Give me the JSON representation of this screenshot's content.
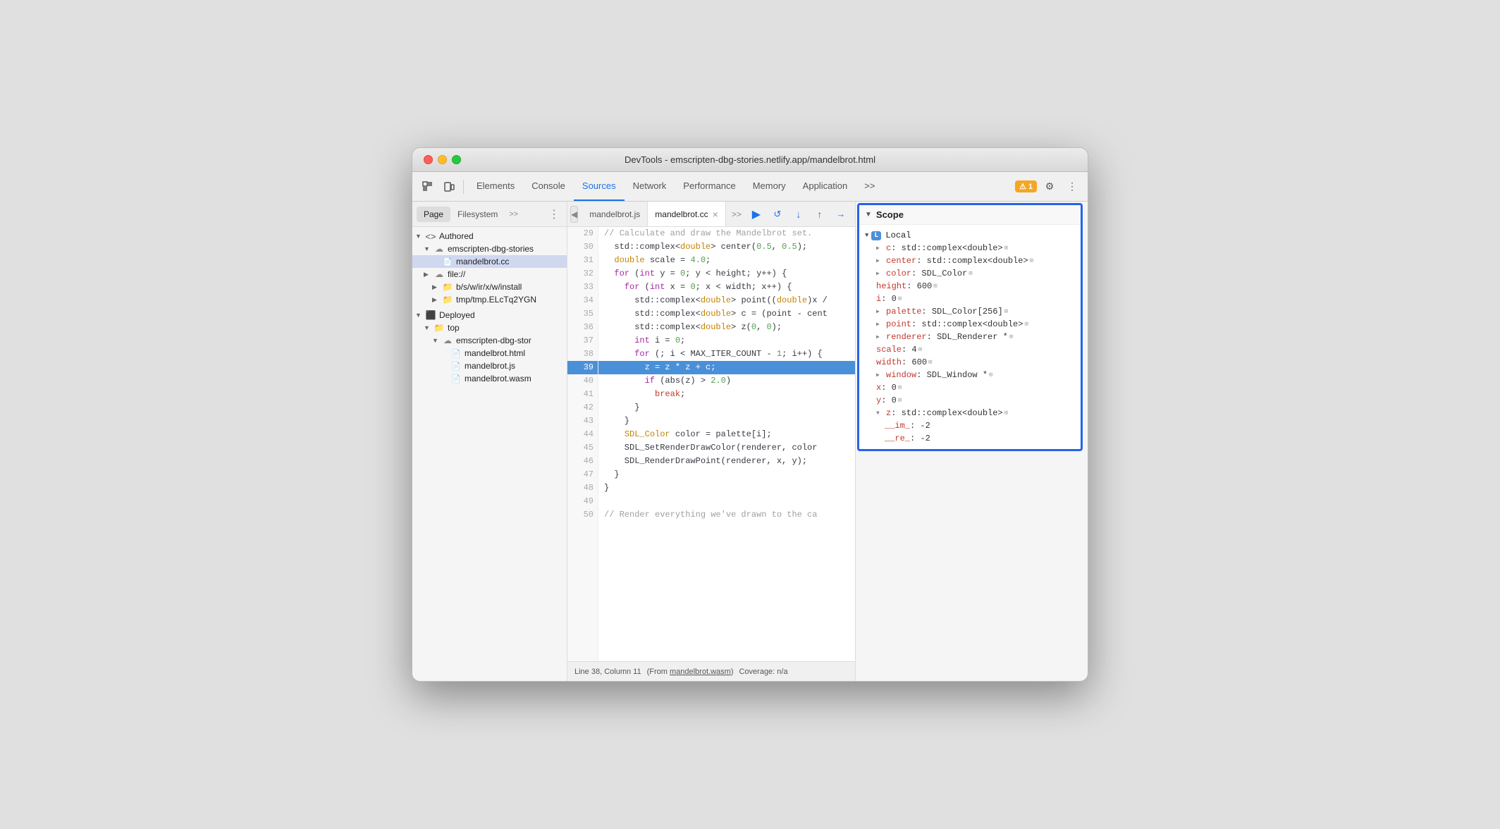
{
  "window": {
    "title": "DevTools - emscripten-dbg-stories.netlify.app/mandelbrot.html"
  },
  "toolbar": {
    "tabs": [
      {
        "label": "Elements",
        "active": false
      },
      {
        "label": "Console",
        "active": false
      },
      {
        "label": "Sources",
        "active": true
      },
      {
        "label": "Network",
        "active": false
      },
      {
        "label": "Performance",
        "active": false
      },
      {
        "label": "Memory",
        "active": false
      },
      {
        "label": "Application",
        "active": false
      }
    ],
    "more_tabs_label": ">>",
    "warning_count": "1",
    "warning_icon": "⚠"
  },
  "sidebar": {
    "tabs": [
      {
        "label": "Page",
        "active": true
      },
      {
        "label": "Filesystem",
        "active": false
      }
    ],
    "more_label": ">>",
    "tree": [
      {
        "id": "authored",
        "level": 0,
        "label": "Authored",
        "icon": "arrow",
        "type": "section-header"
      },
      {
        "id": "emscripten-cloud",
        "level": 1,
        "label": "emscripten-dbg-stories",
        "icon": "cloud",
        "type": "cloud"
      },
      {
        "id": "mandelbrot-cc",
        "level": 2,
        "label": "mandelbrot.cc",
        "icon": "file-cc",
        "type": "file",
        "selected": true
      },
      {
        "id": "file-proto",
        "level": 1,
        "label": "file://",
        "icon": "cloud",
        "type": "cloud-collapsed"
      },
      {
        "id": "b-folder",
        "level": 2,
        "label": "b/s/w/ir/x/w/install",
        "icon": "folder",
        "type": "folder"
      },
      {
        "id": "tmp-folder",
        "level": 2,
        "label": "tmp/tmp.ELcTq2YGN",
        "icon": "folder",
        "type": "folder"
      },
      {
        "id": "deployed",
        "level": 0,
        "label": "Deployed",
        "icon": "box",
        "type": "section-header"
      },
      {
        "id": "top-folder",
        "level": 1,
        "label": "top",
        "icon": "folder",
        "type": "folder-expanded"
      },
      {
        "id": "emscripten-deployed",
        "level": 2,
        "label": "emscripten-dbg-stor",
        "icon": "cloud",
        "type": "cloud-expanded"
      },
      {
        "id": "mandelbrot-html",
        "level": 3,
        "label": "mandelbrot.html",
        "icon": "file-html",
        "type": "file"
      },
      {
        "id": "mandelbrot-js",
        "level": 3,
        "label": "mandelbrot.js",
        "icon": "file-js",
        "type": "file"
      },
      {
        "id": "mandelbrot-wasm",
        "level": 3,
        "label": "mandelbrot.wasm",
        "icon": "file-wasm",
        "type": "file"
      }
    ]
  },
  "editor": {
    "tabs": [
      {
        "label": "mandelbrot.js",
        "active": false,
        "closeable": false
      },
      {
        "label": "mandelbrot.cc",
        "active": true,
        "closeable": true
      }
    ],
    "lines": [
      {
        "n": 29,
        "code": "// Calculate and draw the Mandelbrot set.",
        "highlight": false
      },
      {
        "n": 30,
        "code": "  std::complex<double> center(0.5, 0.5);",
        "highlight": false
      },
      {
        "n": 31,
        "code": "  double scale = 4.0;",
        "highlight": false
      },
      {
        "n": 32,
        "code": "  for (int y = 0; y < height; y++) {",
        "highlight": false
      },
      {
        "n": 33,
        "code": "    for (int x = 0; x < width; x++) {",
        "highlight": false
      },
      {
        "n": 34,
        "code": "      std::complex<double> point((double)x /",
        "highlight": false
      },
      {
        "n": 35,
        "code": "      std::complex<double> c = (point - cent",
        "highlight": false
      },
      {
        "n": 36,
        "code": "      std::complex<double> z(0, 0);",
        "highlight": false
      },
      {
        "n": 37,
        "code": "      int i = 0;",
        "highlight": false
      },
      {
        "n": 38,
        "code": "      for (; i < MAX_ITER_COUNT - 1; i++) {",
        "highlight": false
      },
      {
        "n": 39,
        "code": "        z = z * z + c;",
        "highlight": false
      },
      {
        "n": 40,
        "code": "        if (abs(z) > 2.0)",
        "highlight": true
      },
      {
        "n": 41,
        "code": "          break;",
        "highlight": false
      },
      {
        "n": 42,
        "code": "      }",
        "highlight": false
      },
      {
        "n": 43,
        "code": "    }",
        "highlight": false
      },
      {
        "n": 44,
        "code": "    SDL_Color color = palette[i];",
        "highlight": false
      },
      {
        "n": 45,
        "code": "    SDL_SetRenderDrawColor(renderer, color",
        "highlight": false
      },
      {
        "n": 46,
        "code": "    SDL_RenderDrawPoint(renderer, x, y);",
        "highlight": false
      },
      {
        "n": 47,
        "code": "  }",
        "highlight": false
      },
      {
        "n": 48,
        "code": "}",
        "highlight": false
      },
      {
        "n": 49,
        "code": "",
        "highlight": false
      },
      {
        "n": 50,
        "code": "// Render everything we've drawn to the ca",
        "highlight": false
      }
    ]
  },
  "scope": {
    "title": "Scope",
    "local_label": "Local",
    "local_badge": "L",
    "items": [
      {
        "key": "c",
        "value": "std::complex<double>",
        "expandable": true,
        "has_grid": true
      },
      {
        "key": "center",
        "value": "std::complex<double>",
        "expandable": true,
        "has_grid": true
      },
      {
        "key": "color",
        "value": "SDL_Color",
        "expandable": true,
        "has_grid": true
      },
      {
        "key": "height",
        "value": "600",
        "expandable": false,
        "has_grid": true
      },
      {
        "key": "i",
        "value": "0",
        "expandable": false,
        "has_grid": true
      },
      {
        "key": "palette",
        "value": "SDL_Color[256]",
        "expandable": true,
        "has_grid": true
      },
      {
        "key": "point",
        "value": "std::complex<double>",
        "expandable": true,
        "has_grid": true
      },
      {
        "key": "renderer",
        "value": "SDL_Renderer *",
        "expandable": true,
        "has_grid": true
      },
      {
        "key": "scale",
        "value": "4",
        "expandable": false,
        "has_grid": true
      },
      {
        "key": "width",
        "value": "600",
        "expandable": false,
        "has_grid": true
      },
      {
        "key": "window",
        "value": "SDL_Window *",
        "expandable": true,
        "has_grid": true
      },
      {
        "key": "x",
        "value": "0",
        "expandable": false,
        "has_grid": true
      },
      {
        "key": "y",
        "value": "0",
        "expandable": false,
        "has_grid": true
      },
      {
        "key": "z",
        "value": "std::complex<double>",
        "expandable": true,
        "has_grid": true,
        "expanded": true
      }
    ],
    "z_subitems": [
      {
        "key": "__im_",
        "value": "-2"
      },
      {
        "key": "__re_",
        "value": "-2"
      }
    ]
  },
  "status_bar": {
    "text": "Line 38, Column 11",
    "from_label": "(From",
    "from_file": "mandelbrot.wasm",
    "from_end": ")",
    "coverage": "Coverage: n/a"
  }
}
